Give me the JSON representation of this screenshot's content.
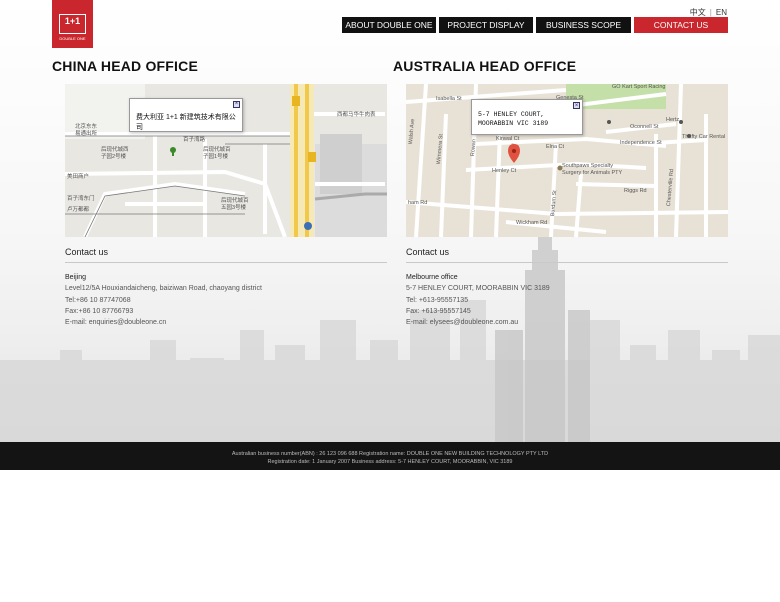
{
  "header": {
    "logo": {
      "mark": "1+1",
      "text": "DOUBLE ONE",
      "icon": "double-one-logo"
    },
    "languages": [
      "中文",
      "EN"
    ]
  },
  "nav": {
    "items": [
      {
        "label": "ABOUT DOUBLE ONE"
      },
      {
        "label": "PROJECT DISPLAY"
      },
      {
        "label": "BUSINESS SCOPE"
      },
      {
        "label": "CONTACT US"
      }
    ],
    "active_index": 3,
    "active_color": "#c9272d"
  },
  "offices": [
    {
      "title": "CHINA HEAD OFFICE",
      "map": {
        "popup": "费大利亚 1+1 新建筑技术有限公司",
        "labels": [
          "北京东东",
          "易通出所",
          "百子湾路",
          "后现代城西",
          "子园2号楼",
          "后现代城百",
          "子园1号楼",
          "美田商户",
          "百子湾东门",
          "西都马华牛肉表",
          "后现代城百",
          "五园3号楼",
          "卢万都都"
        ]
      },
      "contact": {
        "heading": "Contact us",
        "city": "Beijing",
        "lines": [
          "Level12/5A Houxiandaicheng, baiziwan Road, chaoyang district",
          "Tel:+86 10 87747068",
          "Fax:+86 10 87766793",
          "E-mail: enquiries@doubleone.cn"
        ]
      }
    },
    {
      "title": "AUSTRALIA HEAD OFFICE",
      "map": {
        "popup": "5-7 HENLEY COURT, MOORABBIN VIC 3189",
        "labels": [
          "Isabella St",
          "Genesta St",
          "GO Kart Sport Racing",
          "Oconnell St",
          "Hertz",
          "Thrifty Car Rental",
          "Independence St",
          "Kinwal Ct",
          "Elna Ct",
          "Southpaws Specialty",
          "Surgery for Animals PTY",
          "Henley Ct",
          "Riggs Rd",
          "Walsh Ave",
          "Wimmera St",
          "Rowan",
          "Burdum St",
          "Chesterville Rd",
          "ham Rd",
          "Wickham Rd"
        ]
      },
      "contact": {
        "heading": "Contact us",
        "city": "Melbourne office",
        "lines": [
          "5-7 HENLEY COURT, MOORABBIN VIC 3189",
          "Tel: +613-95557135",
          "Fax: +613-95557145",
          "E-mail: elysees@doubleone.com.au"
        ]
      }
    }
  ],
  "footer": {
    "line1": "Australian business number(ABN) : 26 123 096 688 Registration name: DOUBLE ONE NEW BUILDING TECHNOLOGY PTY LTD",
    "line2": "Registration date: 1 January 2007 Business address: 5-7 HENLEY COURT, MOORABBIN, VIC 3189"
  }
}
